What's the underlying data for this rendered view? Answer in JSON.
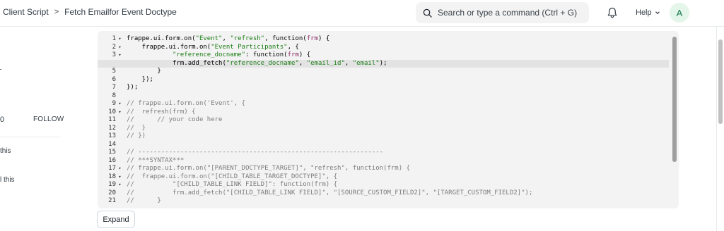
{
  "breadcrumb": {
    "items": [
      "Client Script",
      "Fetch Emailfor Event Doctype"
    ],
    "separator": ">"
  },
  "search": {
    "placeholder": "Search or type a command (Ctrl + G)"
  },
  "nav": {
    "help_label": "Help",
    "avatar_letter": "A",
    "bell_icon": "bell-icon"
  },
  "sidebar": {
    "count": "0",
    "follow_label": "FOLLOW",
    "fragment_1": "this",
    "fragment_2": "l this"
  },
  "editor": {
    "lines": [
      {
        "n": "1",
        "fold": true
      },
      {
        "n": "2",
        "fold": true
      },
      {
        "n": "3",
        "fold": true
      },
      {
        "n": "4",
        "fold": false
      },
      {
        "n": "5",
        "fold": false
      },
      {
        "n": "6",
        "fold": false
      },
      {
        "n": "7",
        "fold": false
      },
      {
        "n": "8",
        "fold": false
      },
      {
        "n": "9",
        "fold": true
      },
      {
        "n": "10",
        "fold": true
      },
      {
        "n": "11",
        "fold": false
      },
      {
        "n": "12",
        "fold": false
      },
      {
        "n": "13",
        "fold": false
      },
      {
        "n": "14",
        "fold": false
      },
      {
        "n": "15",
        "fold": false
      },
      {
        "n": "16",
        "fold": false
      },
      {
        "n": "17",
        "fold": true
      },
      {
        "n": "18",
        "fold": true
      },
      {
        "n": "19",
        "fold": true
      },
      {
        "n": "20",
        "fold": false
      },
      {
        "n": "21",
        "fold": false
      }
    ],
    "code": [
      "frappe.ui.form.on(\"Event\", \"refresh\", function(frm) {",
      "    frappe.ui.form.on(\"Event Participants\", {",
      "            \"reference_docname\": function(frm) {",
      "            frm.add_fetch(\"reference_docname\", \"email_id\", \"email\");",
      "        }",
      "    });",
      "});",
      "",
      "// frappe.ui.form.on('Event', {",
      "//  refresh(frm) {",
      "//      // your code here",
      "//  }",
      "// })",
      "",
      "// ----------------------------------------------------------------",
      "// ***SYNTAX***",
      "// frappe.ui.form.on(\"[PARENT_DOCTYPE_TARGET]\", \"refresh\", function(frm) {",
      "//  frappe.ui.form.on(\"[CHILD_TABLE_TARGET_DOCTYPE]\", {",
      "//          \"[CHILD_TABLE_LINK FIELD]\": function(frm) {",
      "//          frm.add_fetch(\"[CHILD_TABLE_LINK FIELD]\", \"[SOURCE_CUSTOM_FIELD2]\", \"[TARGET_CUSTOM_FIELD2]\");",
      "//      }"
    ],
    "highlighted_line": 4
  },
  "expand_label": "Expand",
  "colors": {
    "string": "#1a7d14",
    "param": "#8a2c68",
    "comment": "#7c7c7c",
    "editor_bg": "#f3f3f3",
    "avatar_bg": "#e4f5e9",
    "avatar_fg": "#16794c"
  }
}
